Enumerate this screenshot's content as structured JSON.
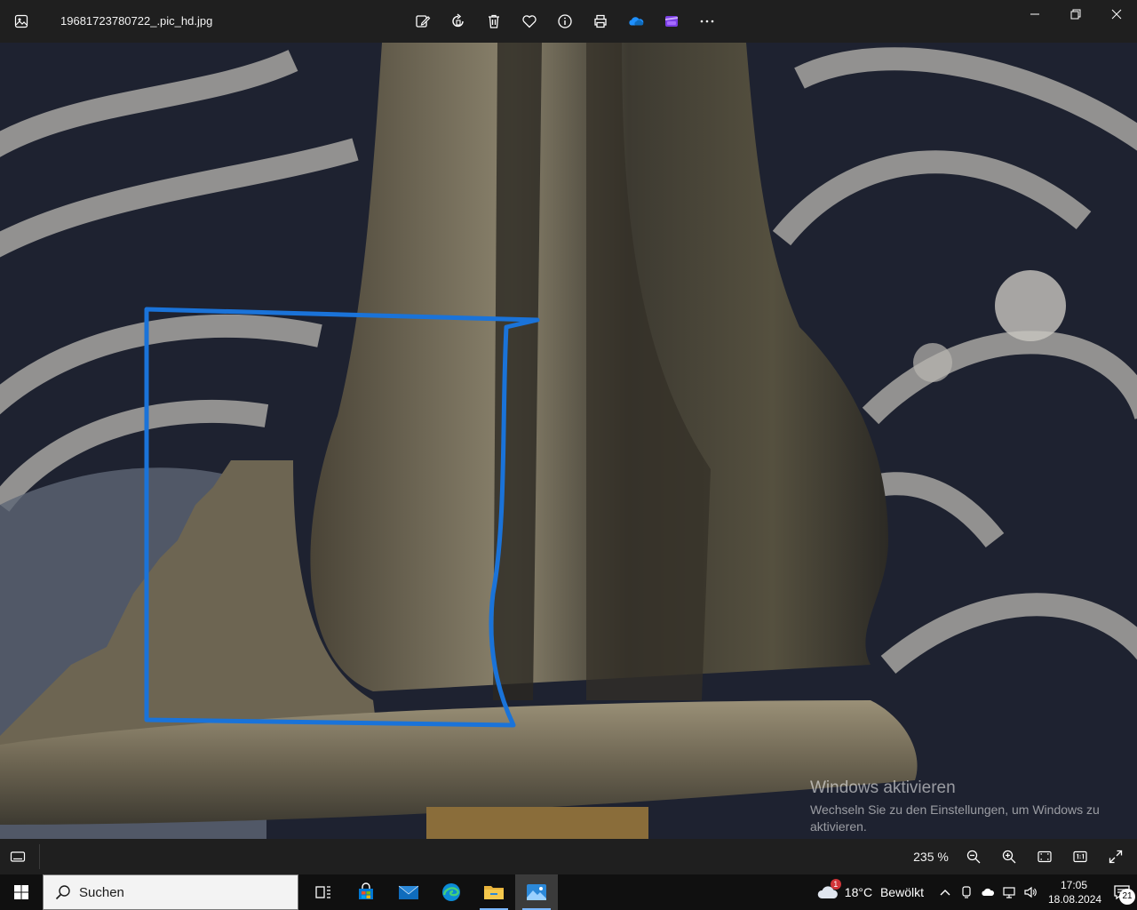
{
  "titlebar": {
    "filename": "19681723780722_.pic_hd.jpg",
    "toolbar": [
      "edit-icon",
      "rotate-icon",
      "delete-icon",
      "favorite-icon",
      "info-icon",
      "print-icon",
      "onedrive-icon",
      "clipchamp-icon",
      "more-icon"
    ],
    "window_controls": [
      "minimize-icon",
      "restore-icon",
      "close-icon"
    ]
  },
  "viewer": {
    "zoom_label": "235 %",
    "watermark_title": "Windows aktivieren",
    "watermark_sub": "Wechseln Sie zu den Einstellungen, um Windows zu aktivieren.",
    "annotation_color": "#1a73d9"
  },
  "taskbar": {
    "search_placeholder": "Suchen",
    "apps": [
      "task-view-icon",
      "microsoft-store-icon",
      "mail-icon",
      "edge-icon",
      "file-explorer-icon",
      "photos-icon"
    ],
    "active_app": "photos-icon",
    "weather": {
      "temp": "18°C",
      "condition": "Bewölkt",
      "badge": "1"
    },
    "clock": {
      "time": "17:05",
      "date": "18.08.2024"
    },
    "notification_count": "21"
  }
}
